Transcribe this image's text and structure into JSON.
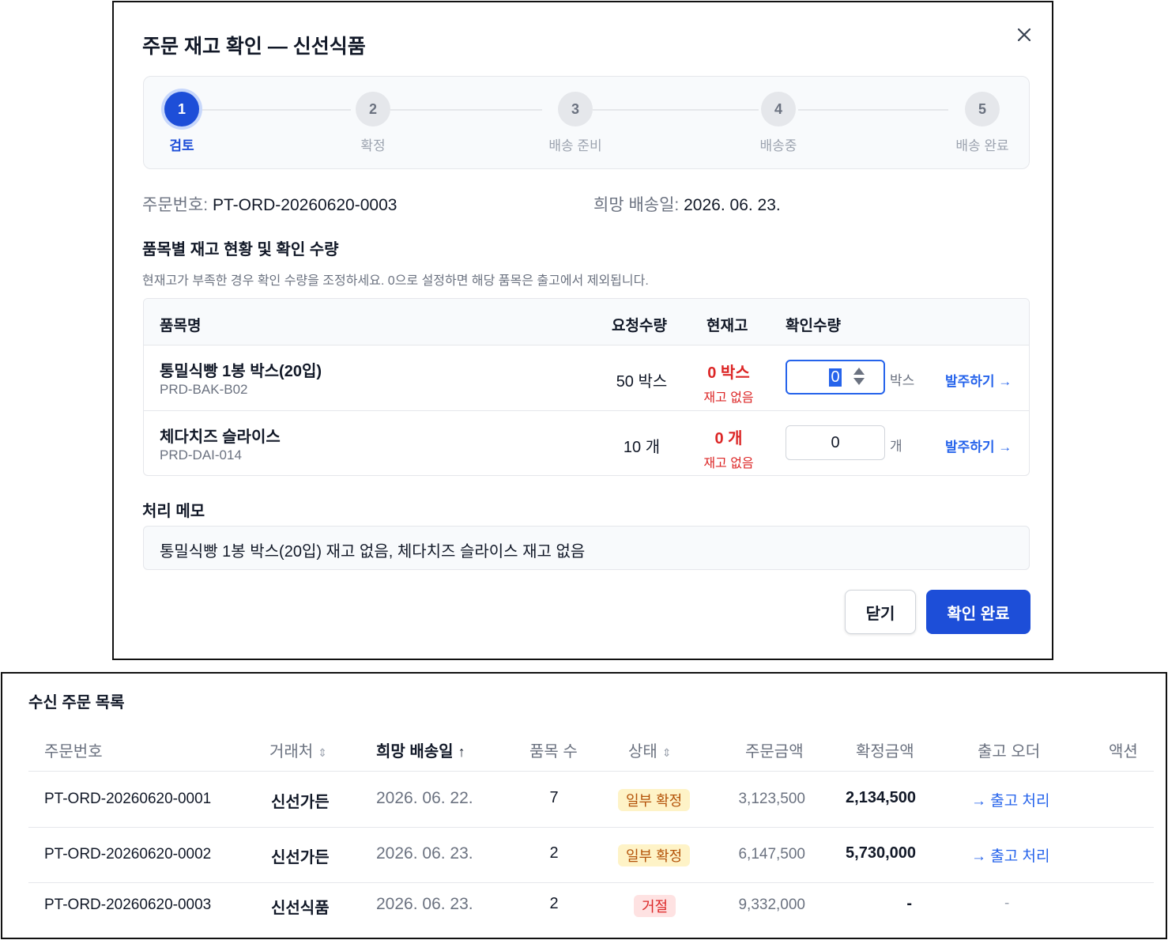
{
  "modal": {
    "title": "주문 재고 확인 — 신선식품",
    "steps": [
      {
        "num": "1",
        "label": "검토"
      },
      {
        "num": "2",
        "label": "확정"
      },
      {
        "num": "3",
        "label": "배송 준비"
      },
      {
        "num": "4",
        "label": "배송중"
      },
      {
        "num": "5",
        "label": "배송 완료"
      }
    ],
    "active_step": 1,
    "order_no_label": "주문번호:",
    "order_no": "PT-ORD-20260620-0003",
    "delivery_label": "희망 배송일:",
    "delivery_date": "2026. 06. 23.",
    "section_title": "품목별 재고 현황 및 확인 수량",
    "hint": "현재고가 부족한 경우 확인 수량을 조정하세요. 0으로 설정하면 해당 품목은 출고에서 제외됩니다.",
    "table_headers": {
      "name": "품목명",
      "requested": "요청수량",
      "stock": "현재고",
      "confirm": "확인수량"
    },
    "items": [
      {
        "name": "통밀식빵 1봉 박스(20입)",
        "code": "PRD-BAK-B02",
        "requested": "50 박스",
        "stock": "0 박스",
        "stock_status": "재고 없음",
        "confirm_qty": "0",
        "unit": "박스",
        "po_link": "발주하기 →"
      },
      {
        "name": "체다치즈 슬라이스",
        "code": "PRD-DAI-014",
        "requested": "10 개",
        "stock": "0 개",
        "stock_status": "재고 없음",
        "confirm_qty": "0",
        "unit": "개",
        "po_link": "발주하기 →"
      }
    ],
    "memo_label": "처리 메모",
    "memo": "통밀식빵 1봉 박스(20입) 재고 없음, 체다치즈 슬라이스 재고 없음",
    "close_button": "닫기",
    "confirm_button": "확인 완료",
    "accent_color": "#1d4ed8"
  },
  "orders": {
    "title": "수신 주문 목록",
    "headers": {
      "order_no": "주문번호",
      "partner": "거래처",
      "delivery_date": "희망 배송일",
      "item_count": "품목 수",
      "status": "상태",
      "order_amount": "주문금액",
      "confirmed_amount": "확정금액",
      "shipping_order": "출고 오더",
      "action": "액션"
    },
    "sort_icon_sortable": "⇕",
    "sort_icon_active": "↑",
    "rows": [
      {
        "order_no": "PT-ORD-20260620-0001",
        "partner": "신선가든",
        "delivery_date": "2026. 06. 22.",
        "item_count": "7",
        "status": "일부 확정",
        "status_type": "partial",
        "order_amount": "3,123,500",
        "confirmed_amount": "2,134,500",
        "shipping_order": "출고 처리"
      },
      {
        "order_no": "PT-ORD-20260620-0002",
        "partner": "신선가든",
        "delivery_date": "2026. 06. 23.",
        "item_count": "2",
        "status": "일부 확정",
        "status_type": "partial",
        "order_amount": "6,147,500",
        "confirmed_amount": "5,730,000",
        "shipping_order": "출고 처리"
      },
      {
        "order_no": "PT-ORD-20260620-0003",
        "partner": "신선식품",
        "delivery_date": "2026. 06. 23.",
        "item_count": "2",
        "status": "거절",
        "status_type": "rejected",
        "order_amount": "9,332,000",
        "confirmed_amount": "-",
        "shipping_order": "-"
      }
    ]
  }
}
